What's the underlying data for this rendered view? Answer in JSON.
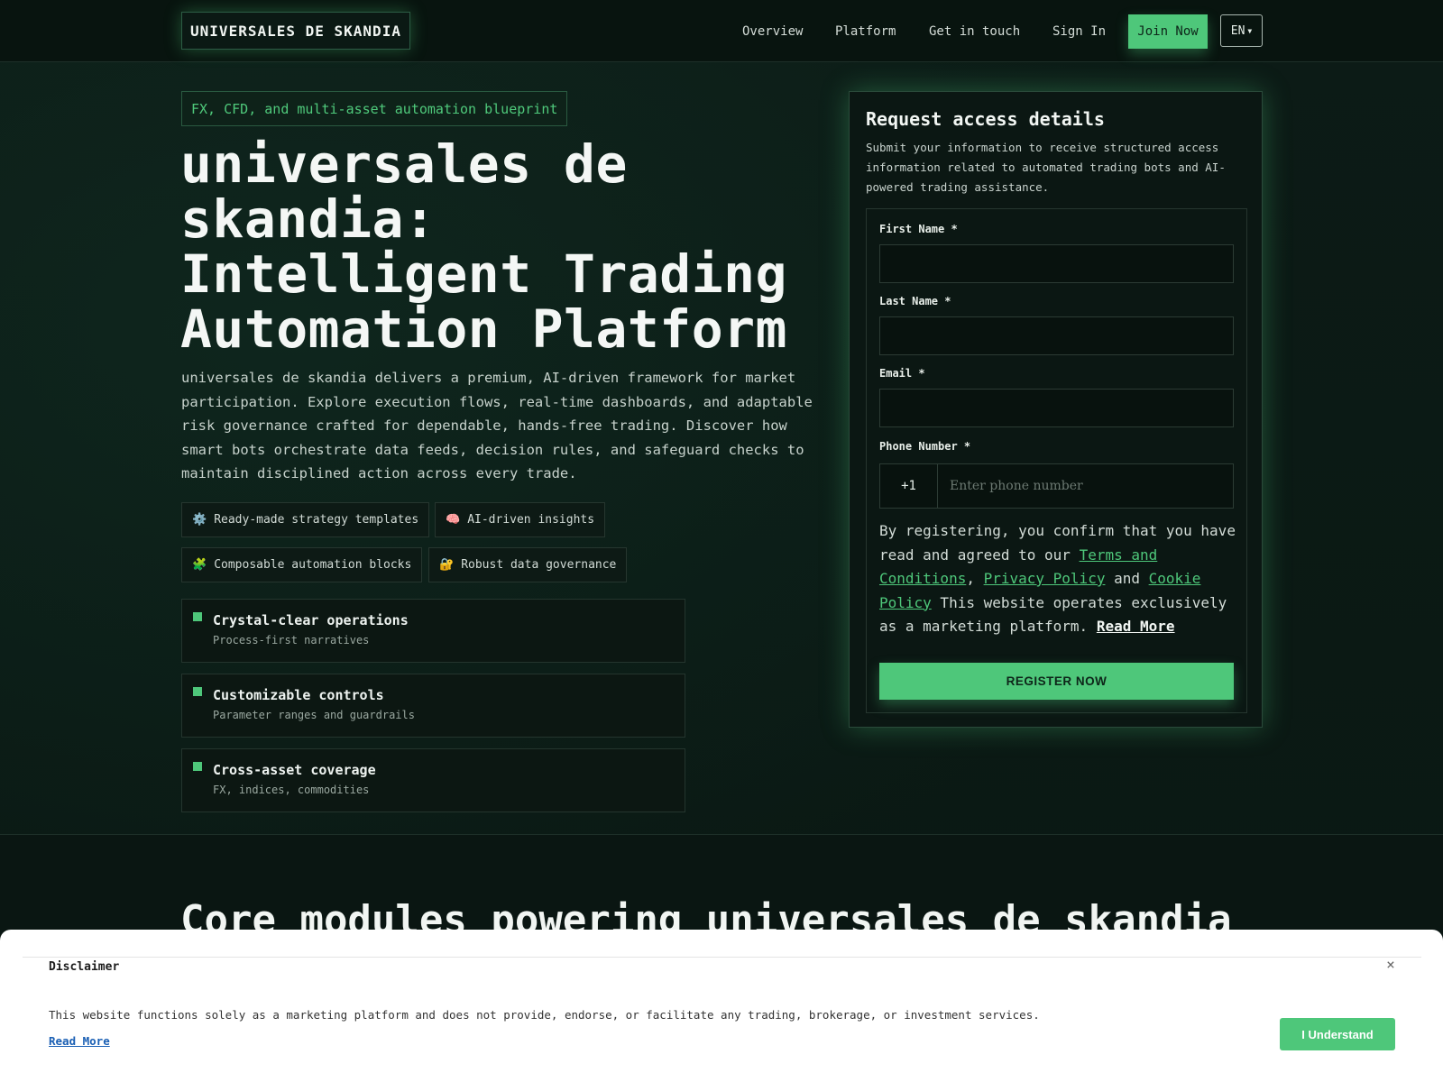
{
  "header": {
    "logo": "UNIVERSALES DE SKANDIA",
    "nav": [
      "Overview",
      "Platform",
      "Get in touch",
      "Sign In"
    ],
    "join_label": "Join Now",
    "lang_label": "EN"
  },
  "hero": {
    "badge": "FX, CFD, and multi-asset automation blueprint",
    "title": "universales de skandia: Intelligent Trading Automation Platform",
    "description": "universales de skandia delivers a premium, AI-driven framework for market participation. Explore execution flows, real-time dashboards, and adaptable risk governance crafted for dependable, hands-free trading. Discover how smart bots orchestrate data feeds, decision rules, and safeguard checks to maintain disciplined action across every trade.",
    "chips": [
      {
        "icon": "⚙️",
        "label": "Ready-made strategy templates"
      },
      {
        "icon": "🧠",
        "label": "AI-driven insights"
      },
      {
        "icon": "🧩",
        "label": "Composable automation blocks"
      },
      {
        "icon": "🔐",
        "label": "Robust data governance"
      }
    ],
    "features": [
      {
        "title": "Crystal-clear operations",
        "subtitle": "Process-first narratives"
      },
      {
        "title": "Customizable controls",
        "subtitle": "Parameter ranges and guardrails"
      },
      {
        "title": "Cross-asset coverage",
        "subtitle": "FX, indices, commodities"
      }
    ]
  },
  "form": {
    "title": "Request access details",
    "description": "Submit your information to receive structured access information related to automated trading bots and AI-powered trading assistance.",
    "first_name_label": "First Name *",
    "first_name_value": "",
    "last_name_label": "Last Name *",
    "last_name_value": "",
    "email_label": "Email *",
    "email_value": "",
    "phone_label": "Phone Number *",
    "phone_code": "+1",
    "phone_placeholder": "Enter phone number",
    "consent_prefix": "By registering, you confirm that you have read and agreed to our ",
    "terms_label": "Terms and Conditions",
    "comma": ", ",
    "privacy_label": "Privacy Policy",
    "and_text": " and ",
    "cookie_label": "Cookie Policy",
    "consent_suffix": " This website operates exclusively as a marketing platform. ",
    "read_more_label": "Read More",
    "register_label": "REGISTER NOW"
  },
  "section": {
    "title": "Core modules powering universales de skandia"
  },
  "disclaimer": {
    "title": "Disclaimer",
    "close_glyph": "×",
    "text": "This website functions solely as a marketing platform and does not provide, endorse, or facilitate any trading, brokerage, or investment services.",
    "read_more_label": "Read More",
    "button_label": "I Understand"
  },
  "colors": {
    "accent": "#4ec77a",
    "background": "#0b1a15"
  }
}
